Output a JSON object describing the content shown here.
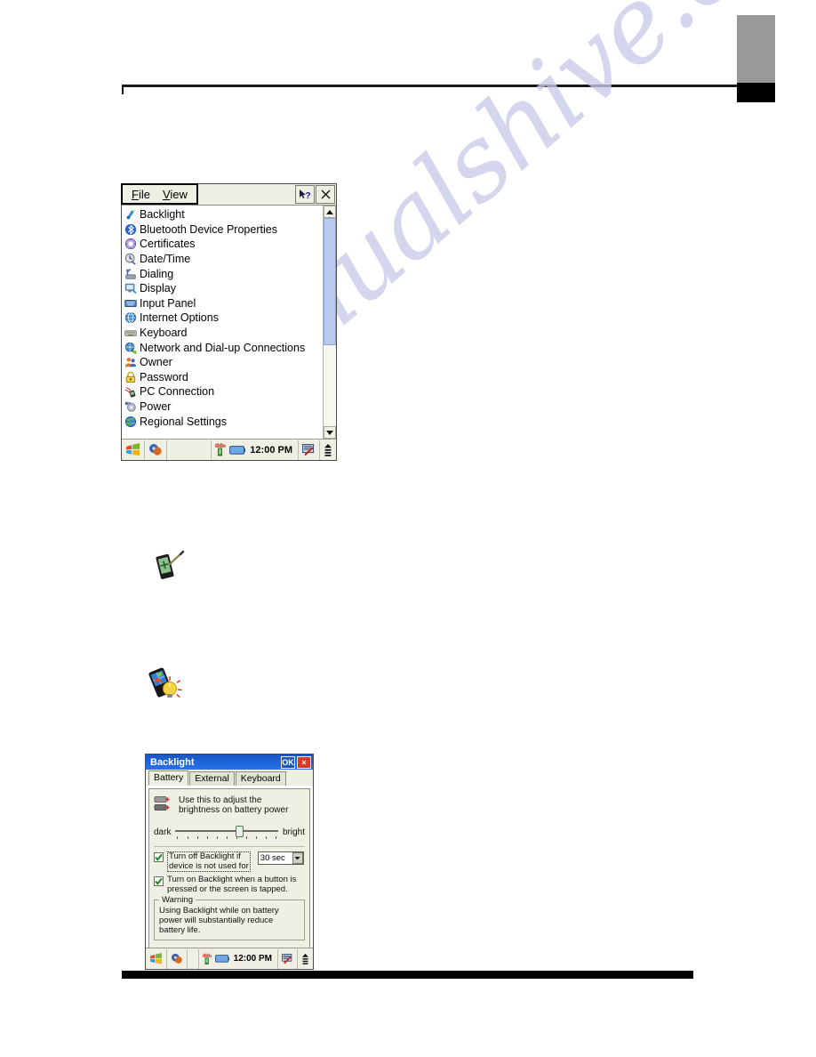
{
  "watermark": {
    "text": "manualshive.com"
  },
  "control_panel": {
    "menu": [
      {
        "label": "File",
        "accel": "F"
      },
      {
        "label": "View",
        "accel": "V"
      }
    ],
    "help_button": "context-help",
    "close_button": "×",
    "items": [
      {
        "label": "Backlight",
        "icon": "backlight-icon"
      },
      {
        "label": "Bluetooth Device Properties",
        "icon": "bluetooth-icon"
      },
      {
        "label": "Certificates",
        "icon": "certificates-icon"
      },
      {
        "label": "Date/Time",
        "icon": "datetime-icon"
      },
      {
        "label": "Dialing",
        "icon": "dialing-icon"
      },
      {
        "label": "Display",
        "icon": "display-icon"
      },
      {
        "label": "Input Panel",
        "icon": "input-panel-icon"
      },
      {
        "label": "Internet Options",
        "icon": "internet-options-icon"
      },
      {
        "label": "Keyboard",
        "icon": "keyboard-icon"
      },
      {
        "label": "Network and Dial-up Connections",
        "icon": "network-icon"
      },
      {
        "label": "Owner",
        "icon": "owner-icon"
      },
      {
        "label": "Password",
        "icon": "password-icon"
      },
      {
        "label": "PC Connection",
        "icon": "pc-connection-icon"
      },
      {
        "label": "Power",
        "icon": "power-icon"
      },
      {
        "label": "Regional Settings",
        "icon": "regional-settings-icon"
      }
    ],
    "taskbar": {
      "start": "start-icon",
      "app": "control-panel-icon",
      "signal": "signal-icon",
      "battery": "battery-icon",
      "clock": "12:00 PM",
      "sip": "input-panel-tray-icon",
      "arrow": "up-arrow-icon"
    }
  },
  "doc_icons": [
    {
      "name": "pda-stylus-icon"
    },
    {
      "name": "pda-backlight-bulb-icon"
    }
  ],
  "backlight_dialog": {
    "title": "Backlight",
    "ok_label": "OK",
    "close_label": "×",
    "tabs": [
      {
        "label": "Battery",
        "active": true
      },
      {
        "label": "External",
        "active": false
      },
      {
        "label": "Keyboard",
        "active": false
      }
    ],
    "description_line1": "Use this to adjust the",
    "description_line2": "brightness on battery power",
    "slider": {
      "min_label": "dark",
      "max_label": "bright",
      "value_percent": 62,
      "tick_count": 11
    },
    "check1": {
      "checked": true,
      "line1": "Turn off Backlight if",
      "line2": "device is not used for",
      "timeout_value": "30 sec"
    },
    "check2": {
      "checked": true,
      "line1": "Turn on Backlight when a button is",
      "line2": "pressed or the screen is tapped."
    },
    "warning": {
      "title": "Warning",
      "line1": "Using Backlight while on battery",
      "line2": "power will substantially reduce",
      "line3": "battery life."
    },
    "taskbar": {
      "start": "start-icon",
      "app": "control-panel-icon",
      "signal": "signal-icon",
      "battery": "battery-icon",
      "clock": "12:00 PM",
      "sip": "input-panel-tray-icon",
      "arrow": "up-arrow-icon"
    }
  }
}
